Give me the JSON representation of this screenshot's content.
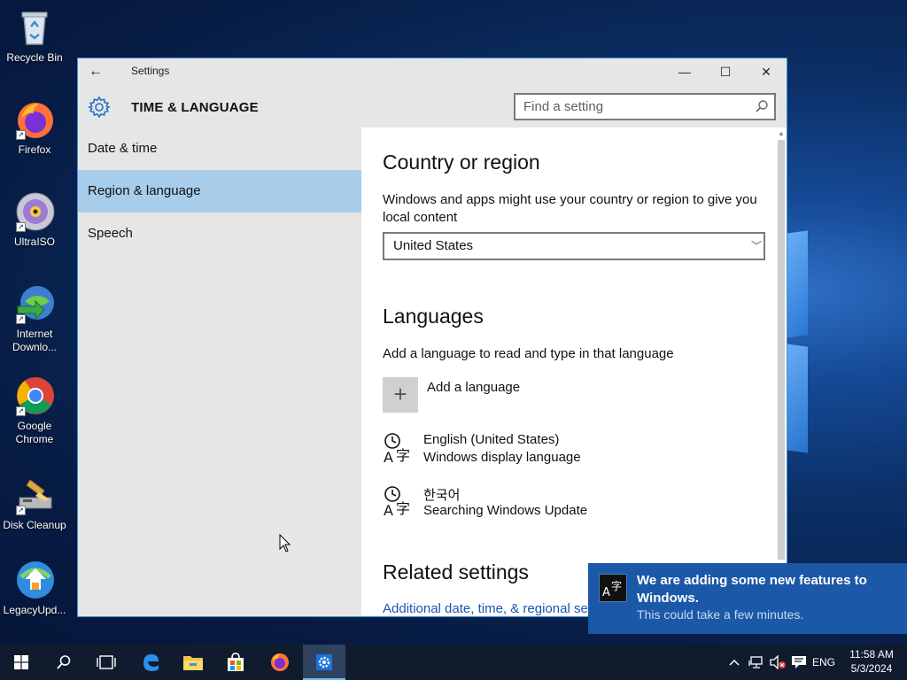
{
  "desktop": {
    "icons": [
      {
        "label": "Recycle Bin",
        "icon": "recycle-bin-icon"
      },
      {
        "label": "Firefox",
        "icon": "firefox-icon"
      },
      {
        "label": "UltraISO",
        "icon": "ultraiso-icon"
      },
      {
        "label": "Internet Downlo...",
        "icon": "internet-download-manager-icon"
      },
      {
        "label": "Google Chrome",
        "icon": "chrome-icon"
      },
      {
        "label": "Disk Cleanup",
        "icon": "disk-cleanup-icon"
      },
      {
        "label": "LegacyUpd...",
        "icon": "legacy-update-icon"
      }
    ]
  },
  "window": {
    "app_title": "Settings",
    "controls": {
      "minimize": "—",
      "maximize": "☐",
      "close": "✕"
    },
    "back_glyph": "←"
  },
  "header": {
    "title": "TIME & LANGUAGE",
    "search_placeholder": "Find a setting"
  },
  "sidebar": {
    "items": [
      {
        "label": "Date & time",
        "active": false
      },
      {
        "label": "Region & language",
        "active": true
      },
      {
        "label": "Speech",
        "active": false
      }
    ]
  },
  "content": {
    "country": {
      "heading": "Country or region",
      "description": "Windows and apps might use your country or region to give you local content",
      "selected": "United States"
    },
    "languages": {
      "heading": "Languages",
      "description": "Add a language to read and type in that language",
      "add_label": "Add a language",
      "items": [
        {
          "name": "English (United States)",
          "status": "Windows display language"
        },
        {
          "name": "한국어",
          "status": "Searching Windows Update"
        }
      ]
    },
    "related": {
      "heading": "Related settings",
      "link": "Additional date, time, & regional settings"
    }
  },
  "toast": {
    "title": "We are adding some new features to Windows.",
    "body": "This could take a few minutes."
  },
  "taskbar": {
    "language": "ENG",
    "time": "11:58 AM",
    "date": "5/3/2024"
  },
  "colors": {
    "accent": "#1b58a7",
    "selection": "#a8cdeb",
    "link": "#1a56b0",
    "taskbar": "#101c2e"
  }
}
